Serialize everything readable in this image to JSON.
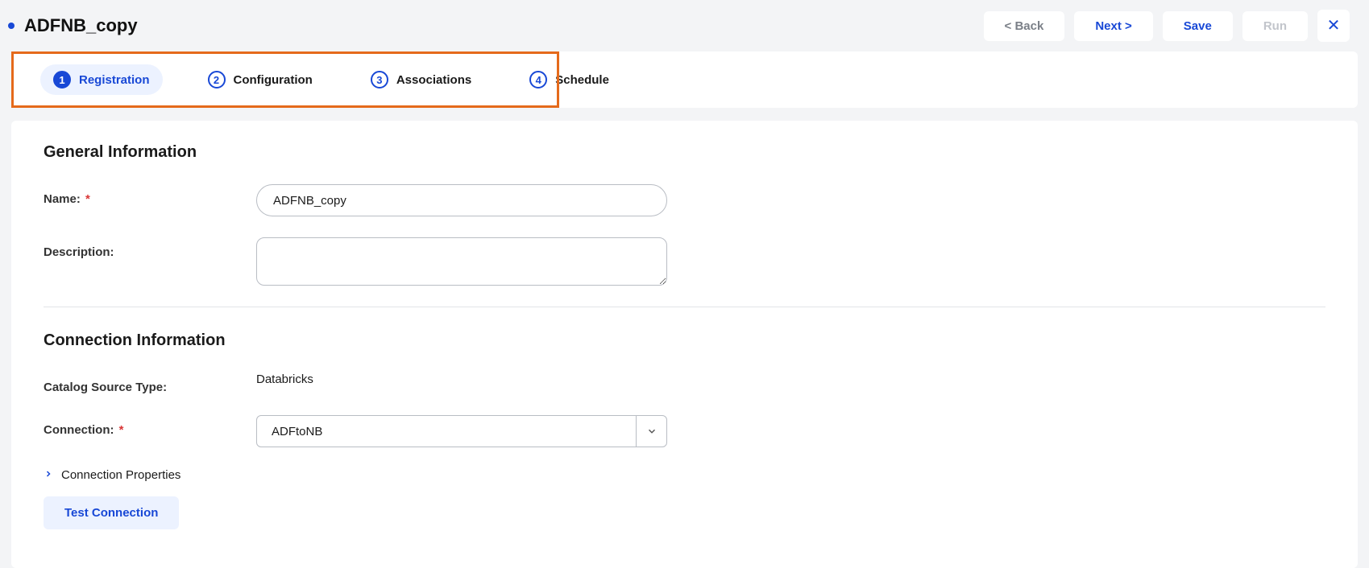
{
  "header": {
    "title": "ADFNB_copy",
    "back_label": "< Back",
    "next_label": "Next >",
    "save_label": "Save",
    "run_label": "Run"
  },
  "stepper": {
    "steps": [
      {
        "num": "1",
        "label": "Registration"
      },
      {
        "num": "2",
        "label": "Configuration"
      },
      {
        "num": "3",
        "label": "Associations"
      },
      {
        "num": "4",
        "label": "Schedule"
      }
    ]
  },
  "sections": {
    "general": {
      "title": "General Information",
      "name_label": "Name:",
      "name_value": "ADFNB_copy",
      "description_label": "Description:",
      "description_value": ""
    },
    "connection": {
      "title": "Connection Information",
      "source_type_label": "Catalog Source Type:",
      "source_type_value": "Databricks",
      "connection_label": "Connection:",
      "connection_value": "ADFtoNB",
      "properties_label": "Connection Properties",
      "test_label": "Test Connection"
    }
  },
  "required_marker": "*"
}
